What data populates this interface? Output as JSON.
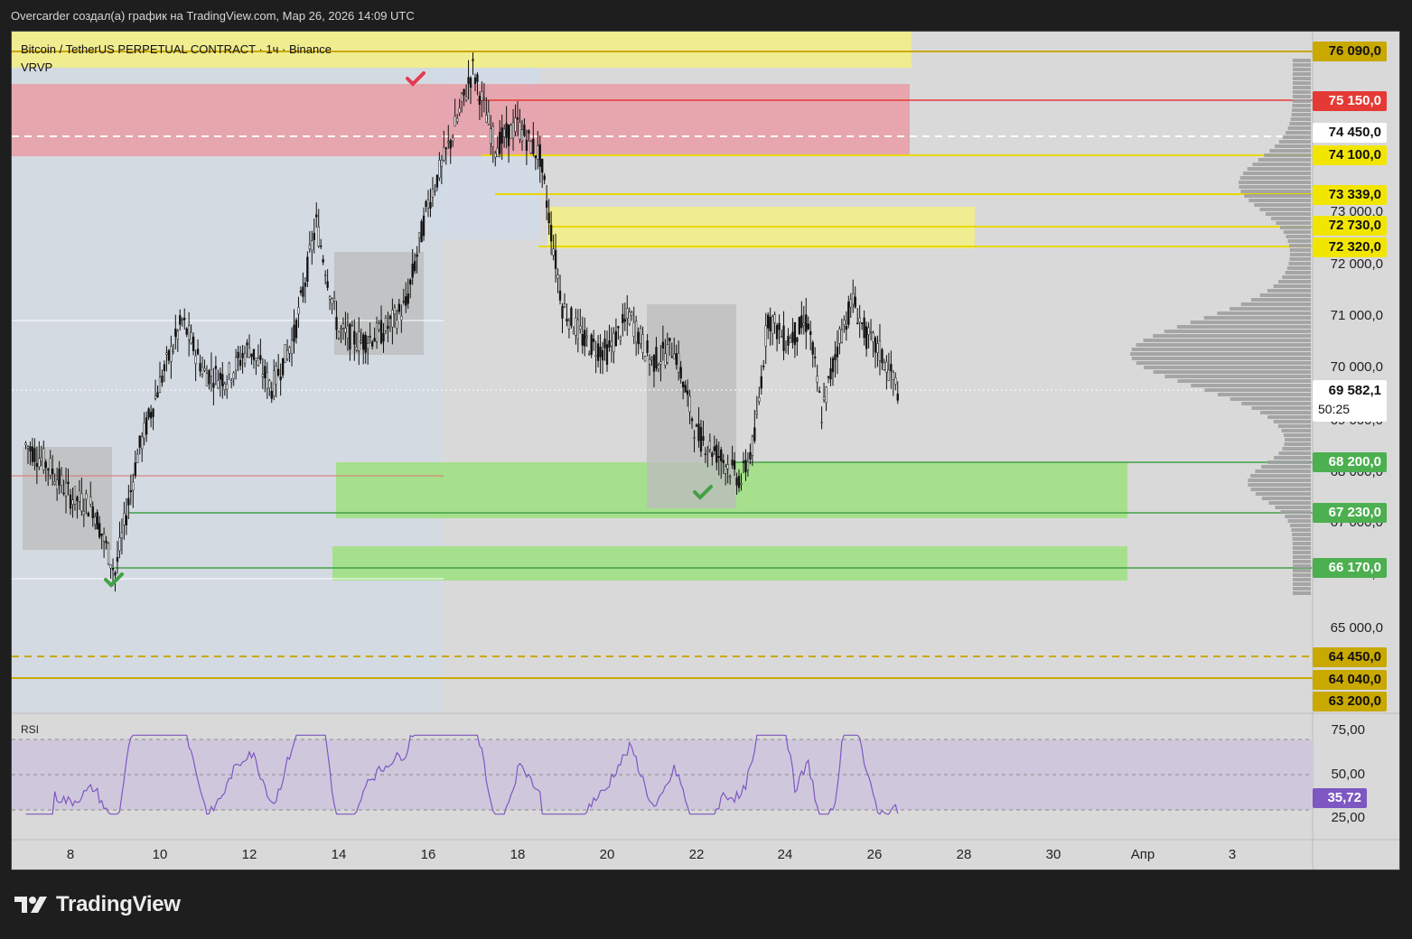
{
  "header": {
    "attribution": "Overcarder создал(а) график на TradingView.com, Мар 26, 2026 14:09 UTC"
  },
  "legend": {
    "symbol": "Bitcoin / TetherUS PERPETUAL CONTRACT · 1ч · Binance",
    "indicator": "VRVP"
  },
  "rsi": {
    "label": "RSI",
    "value": "35,72",
    "levels": [
      "75,00",
      "50,00",
      "25,00"
    ]
  },
  "price_axis": {
    "ticks": [
      "73 000,0",
      "72 000,0",
      "71 000,0",
      "70 000,0",
      "69 000,0",
      "68 000,0",
      "67 000,0",
      "66 000,0",
      "65 000,0"
    ],
    "badges": [
      {
        "label": "76 090,0",
        "kind": "gold"
      },
      {
        "label": "75 150,0",
        "kind": "red"
      },
      {
        "label": "74 450,0",
        "kind": "white"
      },
      {
        "label": "74 100,0",
        "kind": "yellow"
      },
      {
        "label": "73 339,0",
        "kind": "yellow"
      },
      {
        "label": "72 730,0",
        "kind": "yellow"
      },
      {
        "label": "72 320,0",
        "kind": "yellow"
      },
      {
        "label": "69 582,1",
        "kind": "current"
      },
      {
        "label": "68 200,0",
        "kind": "green"
      },
      {
        "label": "67 230,0",
        "kind": "green"
      },
      {
        "label": "66 170,0",
        "kind": "green"
      },
      {
        "label": "64 450,0",
        "kind": "gold"
      },
      {
        "label": "64 040,0",
        "kind": "gold"
      },
      {
        "label": "63 200,0",
        "kind": "gold"
      }
    ],
    "countdown": "50:25"
  },
  "time_axis": {
    "ticks": [
      "8",
      "10",
      "12",
      "14",
      "16",
      "18",
      "20",
      "22",
      "24",
      "26",
      "28",
      "30",
      "Апр",
      "3"
    ]
  },
  "footer": {
    "brand": "TradingView"
  },
  "colors": {
    "bg": "#d9d9d9",
    "candle": "#111111",
    "red_zone": "#e8a0a8",
    "yellow_zone": "#f0ec90",
    "green_zone": "#a6e08c",
    "gray_box": "#bdbdbd",
    "rsi": "#7e57c2",
    "gold": "#c9a800",
    "red_line": "#e53935",
    "green_line": "#43a047",
    "yellow_line": "#e8d800"
  },
  "icons": {
    "sell_marker": "checkmark-red-icon",
    "buy_marker": "checkmark-green-icon"
  }
}
